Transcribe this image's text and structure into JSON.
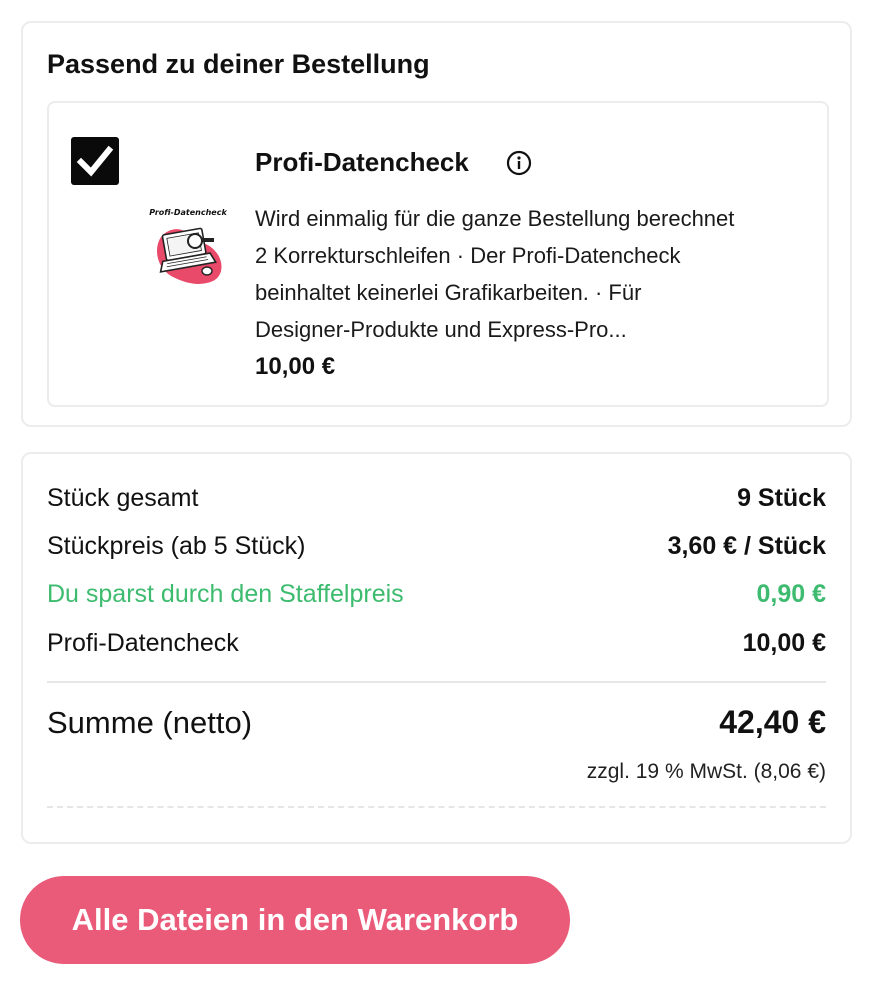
{
  "addon_section": {
    "title": "Passend zu deiner Bestellung",
    "product": {
      "checked": true,
      "thumbnail_caption": "Profi-Datencheck",
      "name": "Profi-Datencheck",
      "description_lines": [
        "Wird einmalig für die ganze Bestellung berechnet",
        "2 Korrekturschleifen · Der Profi-Datencheck",
        "beinhaltet keinerlei Grafikarbeiten. · Für",
        "Designer-Produkte und Express-Pro..."
      ],
      "price": "10,00 €",
      "icons": [
        "checkbox-checked-icon",
        "info-icon"
      ]
    }
  },
  "summary": {
    "rows": [
      {
        "label": "Stück gesamt",
        "value": "9 Stück"
      },
      {
        "label": "Stückpreis (ab 5 Stück)",
        "value": "3,60 € / Stück"
      },
      {
        "label": "Du sparst durch den Staffelpreis",
        "value": "0,90 €"
      },
      {
        "label": "Profi-Datencheck",
        "value": "10,00 €"
      }
    ],
    "total_label": "Summe (netto)",
    "total_value": "42,40 €",
    "tax_note": "zzgl. 19 % MwSt. (8,06 €)"
  },
  "cta": {
    "label": "Alle Dateien in den Warenkorb"
  },
  "colors": {
    "accent": "#ea5a79",
    "savings_green": "#3dbb6f",
    "border": "#ececec",
    "text": "#111111"
  }
}
